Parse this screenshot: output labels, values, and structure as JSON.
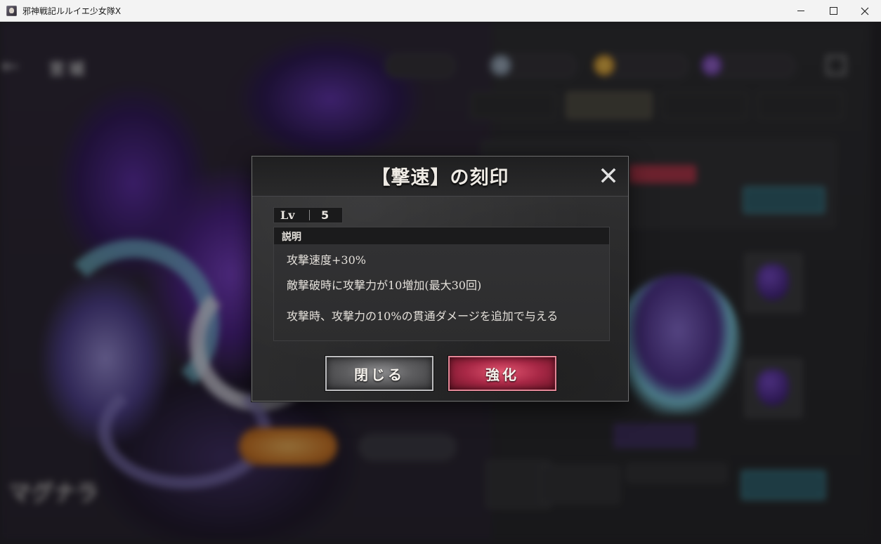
{
  "window": {
    "title": "邪神戦記ルルイエ少女隊X",
    "icon": "app-character-icon",
    "controls": [
      "minimize-icon",
      "maximize-icon",
      "close-icon"
    ]
  },
  "background": {
    "blurred": true,
    "character_name": "マグナラ",
    "screen_label": "宮城"
  },
  "modal": {
    "title": "【撃速】の刻印",
    "level_label": "Lv",
    "level_value": "5",
    "description_header": "説明",
    "description_lines": [
      "攻撃速度+30%",
      "敵撃破時に攻撃力が10増加(最大30回)",
      "攻撃時、攻撃力の10%の貫通ダメージを追加で与える"
    ],
    "close_button": "閉じる",
    "enhance_button": "強化"
  },
  "colors": {
    "modal_bg": "#2e2e2f",
    "enhance_accent": "#a82846",
    "close_button": "#5d5d5f",
    "text": "#eeeae4"
  }
}
